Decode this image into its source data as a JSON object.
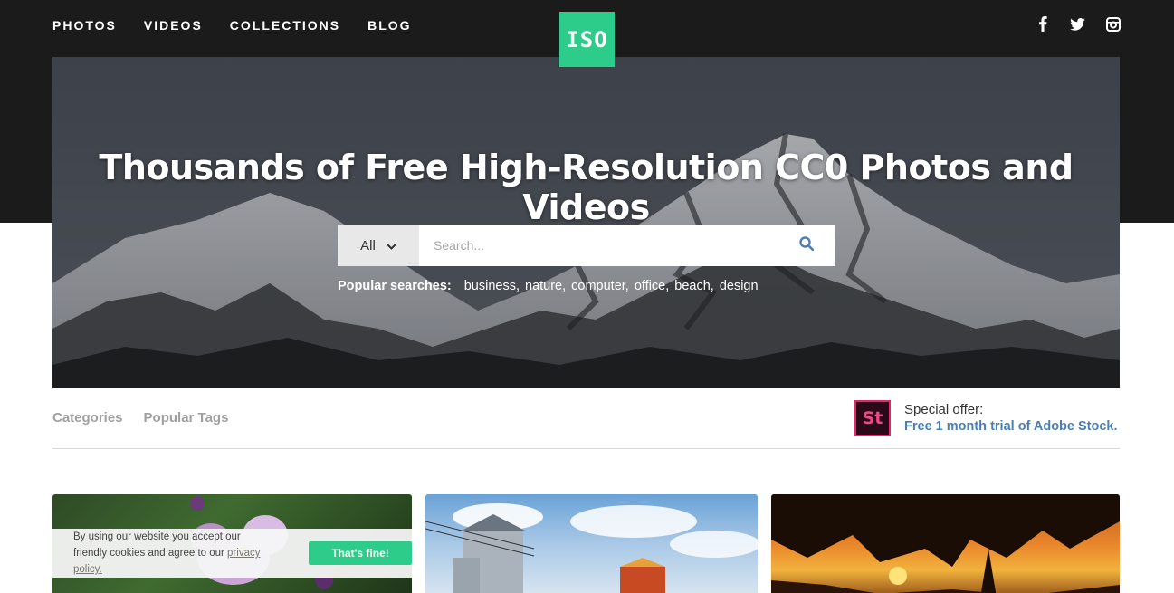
{
  "nav": {
    "items": [
      {
        "label": "PHOTOS"
      },
      {
        "label": "VIDEOS"
      },
      {
        "label": "COLLECTIONS"
      },
      {
        "label": "BLOG"
      }
    ],
    "logo": "ISO",
    "social": [
      "facebook-icon",
      "twitter-icon",
      "instagram-icon"
    ]
  },
  "hero": {
    "title": "Thousands of Free High-Resolution CC0 Photos and Videos",
    "search": {
      "select_value": "All",
      "placeholder": "Search...",
      "value": ""
    },
    "popular_label": "Popular searches:",
    "popular_tags": [
      "business,",
      "nature,",
      "computer,",
      "office,",
      "beach,",
      "design"
    ]
  },
  "tabs": [
    {
      "label": "Categories"
    },
    {
      "label": "Popular Tags"
    }
  ],
  "offer": {
    "logo": "St",
    "top": "Special offer:",
    "link": "Free 1 month trial of Adobe Stock."
  },
  "cookie": {
    "text_before": "By using our website you accept our friendly cookies and agree to our ",
    "link": "privacy policy.",
    "button": "That's fine!"
  },
  "colors": {
    "accent": "#2ecc8a",
    "header_bg": "#1b1b1b",
    "link_blue": "#4a7fb5"
  }
}
